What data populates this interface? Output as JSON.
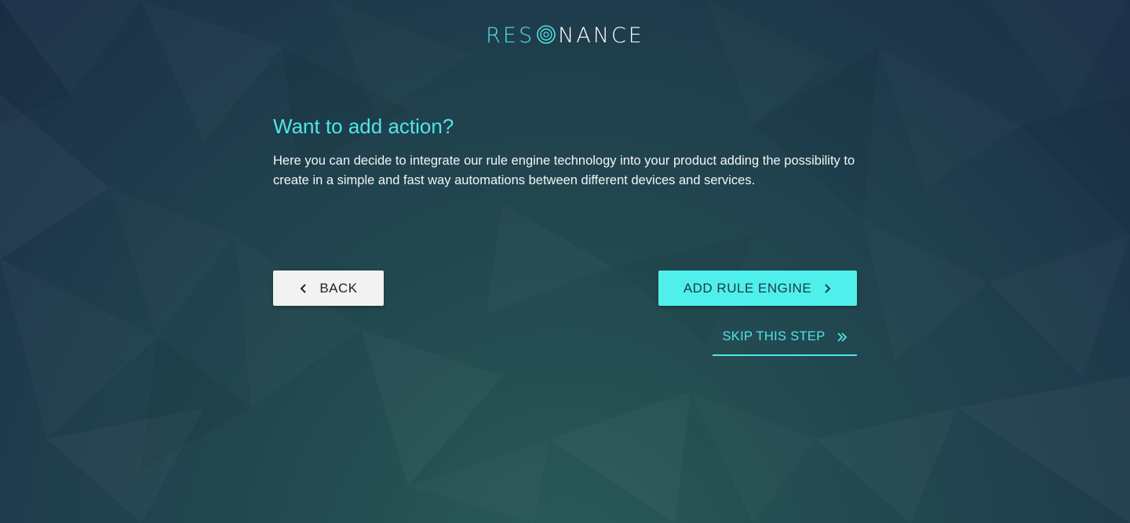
{
  "logo": {
    "part_a": "RES",
    "part_b": "NANCE"
  },
  "main": {
    "title": "Want to add action?",
    "description": "Here you can decide to integrate our rule engine technology into your product adding the possibility to create in a simple and fast way automations between different devices and services."
  },
  "actions": {
    "back_label": "BACK",
    "add_label": "ADD RULE ENGINE",
    "skip_label": "SKIP THIS STEP"
  },
  "icons": {
    "back": "chevron-left-icon",
    "add": "chevron-right-icon",
    "skip": "double-chevron-right-icon",
    "logo_mark": "concentric-circles-icon"
  },
  "colors": {
    "accent": "#4ee6e8",
    "primary_button": "#4ff0ec",
    "secondary_button": "#f2f2f2",
    "background_dark": "#1c2f48",
    "background_teal": "#2a5b58"
  }
}
